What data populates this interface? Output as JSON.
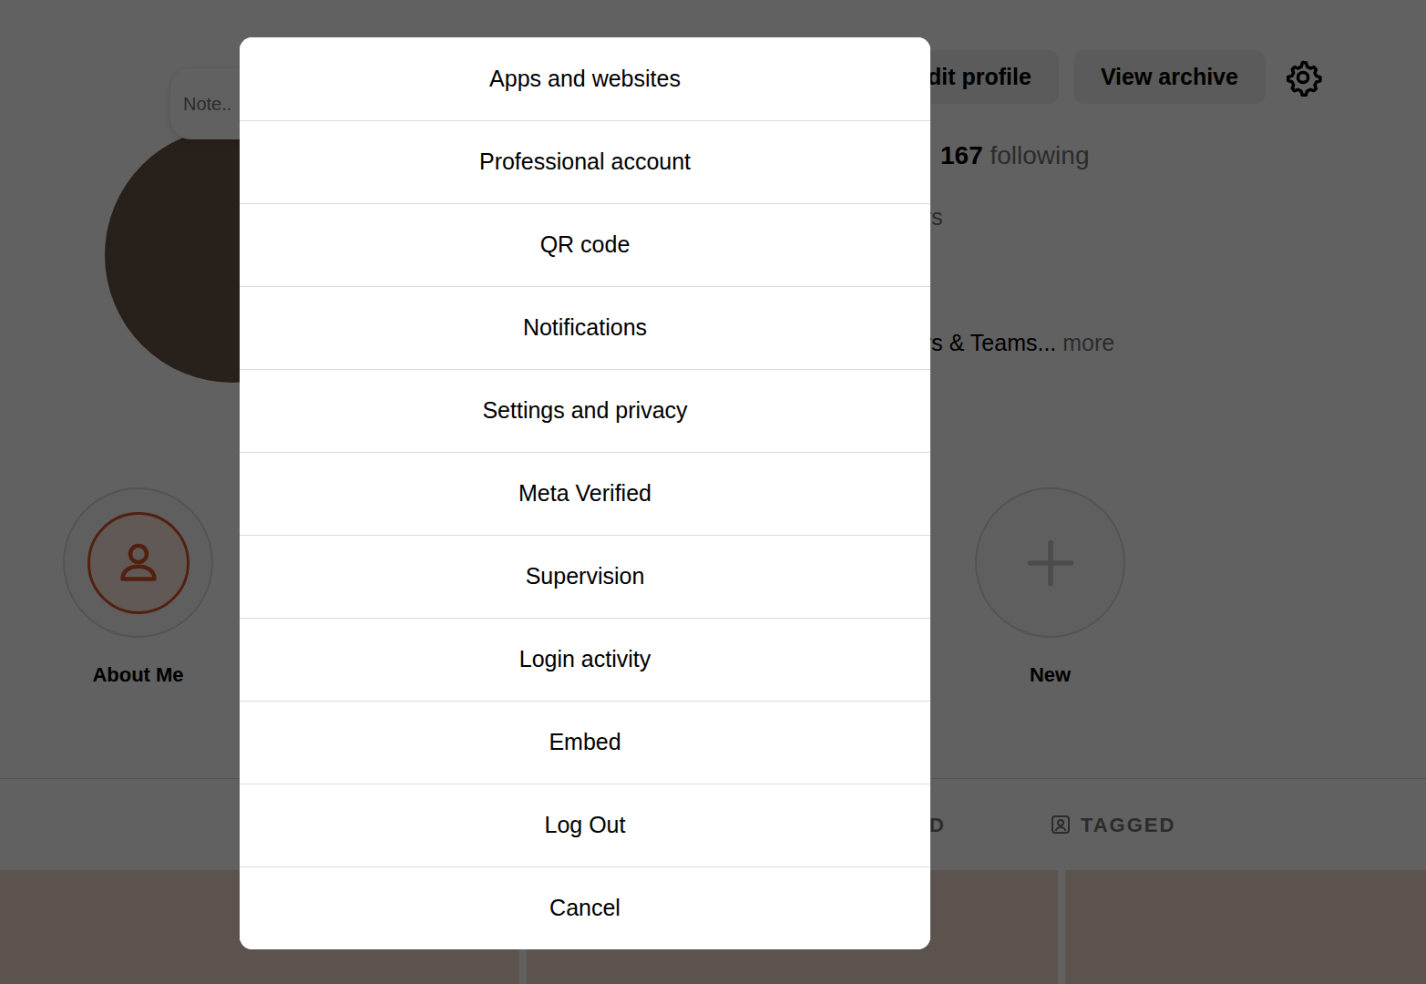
{
  "profile": {
    "note": "Note..",
    "buttons": [
      "dit profile",
      "View archive"
    ],
    "stat": {
      "count": "167",
      "label": "following"
    },
    "sub": "ers",
    "bio": {
      "text": "ers & Teams...",
      "more": "more"
    }
  },
  "highlights": [
    {
      "label": "About Me",
      "kind": "person"
    },
    {
      "label": "New",
      "kind": "add"
    }
  ],
  "tabs": [
    {
      "label": "D"
    },
    {
      "label": "TAGGED"
    }
  ],
  "menu": {
    "items": [
      {
        "label": "Apps and websites"
      },
      {
        "label": "Professional account"
      },
      {
        "label": "QR code"
      },
      {
        "label": "Notifications"
      },
      {
        "label": "Settings and privacy"
      },
      {
        "label": "Meta Verified"
      },
      {
        "label": "Supervision"
      },
      {
        "label": "Login activity"
      },
      {
        "label": "Embed"
      },
      {
        "label": "Log Out"
      },
      {
        "label": "Cancel"
      }
    ]
  }
}
